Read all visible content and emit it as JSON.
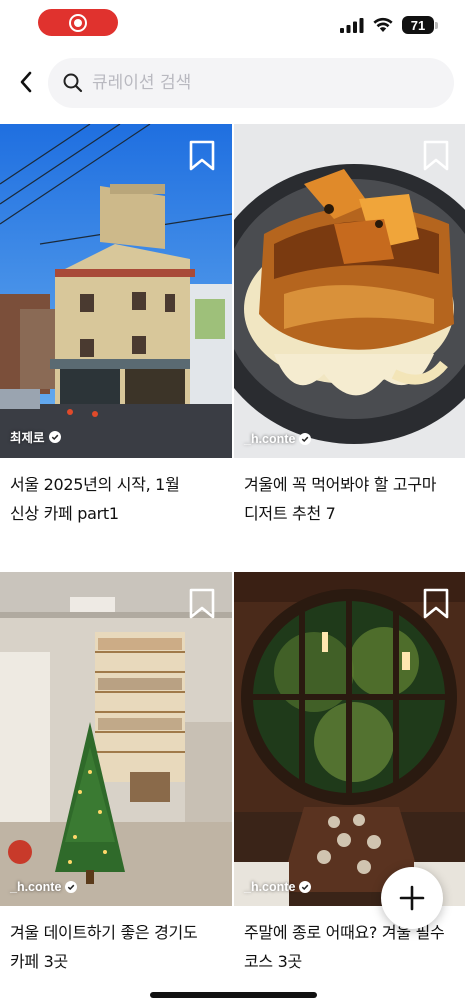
{
  "status_bar": {
    "battery_level": "71"
  },
  "header": {
    "search_placeholder": "큐레이션 검색"
  },
  "cards": [
    {
      "author": "최제로",
      "title_line1": "서울 2025년의 시작, 1월",
      "title_line2": "신상 카페 part1",
      "image": "building-street-photo"
    },
    {
      "author": "_h.conte",
      "title_line1": "겨울에 꼭 먹어봐야 할 고구마",
      "title_line2": "디저트 추천 7",
      "image": "sweet-potato-dessert-photo"
    },
    {
      "author": "_h.conte",
      "title_line1": "겨울 데이트하기 좋은 경기도",
      "title_line2": "카페 3곳",
      "image": "christmas-bookstore-cafe-photo"
    },
    {
      "author": "_h.conte",
      "title_line1": "주말에 종로 어때요? 겨울 필수",
      "title_line2": "코스 3곳",
      "image": "round-window-dining-photo"
    }
  ],
  "colors": {
    "record_pill": "#e0322e",
    "search_bg": "#f4f4f6",
    "placeholder": "#b9b9c0"
  }
}
